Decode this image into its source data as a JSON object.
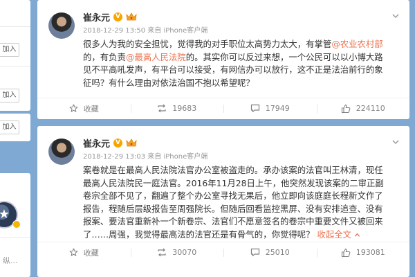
{
  "sidebar": {
    "btn_labels": [
      "关注",
      "加入",
      "加入",
      "加入"
    ],
    "bottom_text": "纵..."
  },
  "posts": [
    {
      "author": "崔永元",
      "verified_badge": "V",
      "meta": "2018-12-29 13:50 来自 iPhone客户端",
      "body_parts": [
        "很多人为我的安全担忧，觉得我的对手职位太高势力太大，有掌管",
        "@农业农村部",
        "的，有负责",
        "@最高人民法院",
        "的。其实你可以反过来想，一个公民可以以小博大路见不平高吼发声，有平台可以接受，有网信办可以放行，这不正是法治前行的象征吗？有什么理由对依法治国不抱以希望呢？"
      ],
      "actions": {
        "favorite": "收藏",
        "repost": "19683",
        "comment": "17949",
        "like": "224110"
      }
    },
    {
      "author": "崔永元",
      "verified_badge": "V",
      "meta": "2018-12-29 13:03 来自 iPhone客户端",
      "body_text": "案卷就是在最高人民法院法官办公室被盗走的。承办该案的法官叫王林清，现任最高人民法院民一庭法官。2016年11月28日上午，他突然发现该案的二审正副卷宗全部不见了，翻遍了整个办公室寻找无果后，他立即向该庭庭长程新文作了报告，程随后层级报告至周强院长。但随后回看监控黑屏、没有安排追查、没有报案、要法官重新补一个新卷宗、法官们不愿意签名的卷宗中重要文件又被回来了……周强，我觉得最高法的法官还是有骨气的，你觉得呢？",
      "collapse_label": "收起全文",
      "actions": {
        "favorite": "收藏",
        "repost": "30070",
        "comment": "25010",
        "like": "193081"
      }
    }
  ],
  "colors": {
    "link": "#eb7350",
    "background": "#7fa9d3",
    "muted": "#999999"
  }
}
